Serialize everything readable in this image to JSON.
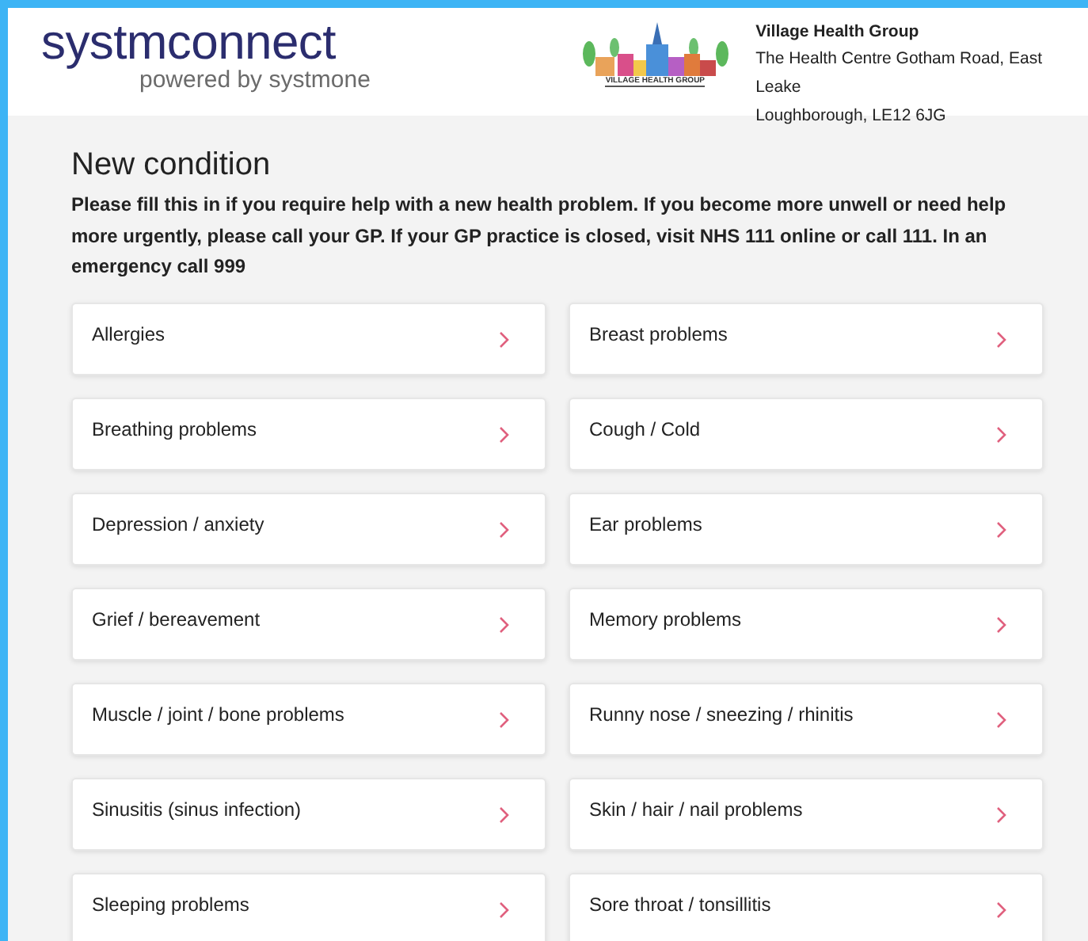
{
  "header": {
    "brand": {
      "name": "systmconnect",
      "tagline": "powered by systmone"
    },
    "practice_logo": {
      "caption": "VILLAGE HEALTH GROUP"
    },
    "practice": {
      "name": "Village Health Group",
      "address_lines": [
        "The Health Centre Gotham Road, East Leake",
        "Loughborough, LE12 6JG"
      ]
    }
  },
  "page": {
    "title": "New condition",
    "intro": "Please fill this in if you require help with a new health problem. If you become more unwell or need help more urgently, please call your GP. If your GP practice is closed, visit NHS 111 online or call 111. In an emergency call 999"
  },
  "conditions": [
    {
      "label": "Allergies"
    },
    {
      "label": "Breast problems"
    },
    {
      "label": "Breathing problems"
    },
    {
      "label": "Cough / Cold"
    },
    {
      "label": "Depression / anxiety"
    },
    {
      "label": "Ear problems"
    },
    {
      "label": "Grief / bereavement"
    },
    {
      "label": "Memory problems"
    },
    {
      "label": "Muscle / joint / bone problems"
    },
    {
      "label": "Runny nose / sneezing / rhinitis"
    },
    {
      "label": "Sinusitis (sinus infection)"
    },
    {
      "label": "Skin / hair / nail problems"
    },
    {
      "label": "Sleeping problems"
    },
    {
      "label": "Sore throat / tonsillitis"
    }
  ]
}
